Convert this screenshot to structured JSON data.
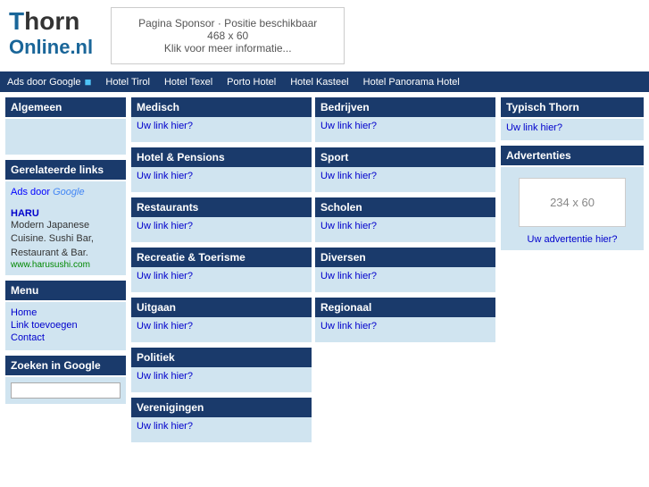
{
  "header": {
    "logo_line1_colored": "T",
    "logo_line1_rest": "horn",
    "logo_line2": "Online.nl",
    "sponsor": {
      "line1": "Pagina Sponsor · Positie beschikbaar",
      "line2": "468 x 60",
      "line3": "Klik voor meer informatie..."
    }
  },
  "ad_bar": {
    "ads_label": "Ads door Google",
    "links": [
      {
        "text": "Hotel Tirol"
      },
      {
        "text": "Hotel Texel"
      },
      {
        "text": "Porto Hotel"
      },
      {
        "text": "Hotel Kasteel"
      },
      {
        "text": "Hotel Panorama Hotel"
      }
    ]
  },
  "sidebar": {
    "algemeen_header": "Algemeen",
    "gerelateerde_header": "Gerelateerde links",
    "ads_label": "Ads door Google",
    "haru_title": "HARU",
    "haru_desc": "Modern Japanese Cuisine. Sushi Bar, Restaurant & Bar.",
    "haru_url": "www.harusushi.com",
    "menu_header": "Menu",
    "menu_links": [
      {
        "text": "Home"
      },
      {
        "text": "Link toevoegen"
      },
      {
        "text": "Contact"
      }
    ],
    "zoeken_header": "Zoeken in Google"
  },
  "content": {
    "categories": [
      {
        "id": "medisch",
        "header": "Medisch",
        "link": "Uw link hier?",
        "col": 1
      },
      {
        "id": "bedrijven",
        "header": "Bedrijven",
        "link": "Uw link hier?",
        "col": 2
      },
      {
        "id": "hotel",
        "header": "Hotel & Pensions",
        "link": "Uw link hier?",
        "col": 1
      },
      {
        "id": "sport",
        "header": "Sport",
        "link": "Uw link hier?",
        "col": 2
      },
      {
        "id": "restaurants",
        "header": "Restaurants",
        "link": "Uw link hier?",
        "col": 1
      },
      {
        "id": "scholen",
        "header": "Scholen",
        "link": "Uw link hier?",
        "col": 2
      },
      {
        "id": "recreatie",
        "header": "Recreatie & Toerisme",
        "link": "Uw link hier?",
        "col": 1
      },
      {
        "id": "diversen",
        "header": "Diversen",
        "link": "Uw link hier?",
        "col": 2
      },
      {
        "id": "uitgaan",
        "header": "Uitgaan",
        "link": "Uw link hier?",
        "col": 1
      },
      {
        "id": "regionaal",
        "header": "Regionaal",
        "link": "Uw link hier?",
        "col": 2
      },
      {
        "id": "politiek",
        "header": "Politiek",
        "link": "Uw link hier?",
        "col": 1
      },
      {
        "id": "verenigingen",
        "header": "Verenigingen",
        "link": "Uw link hier?",
        "col": 1
      }
    ]
  },
  "right_sidebar": {
    "typisch_header": "Typisch Thorn",
    "typisch_link": "Uw link hier?",
    "advertenties_header": "Advertenties",
    "ad_box_label": "234 x 60",
    "ad_link": "Uw advertentie hier?"
  },
  "colors": {
    "nav_bg": "#1a3a6b",
    "content_bg": "#d0e4f0"
  }
}
